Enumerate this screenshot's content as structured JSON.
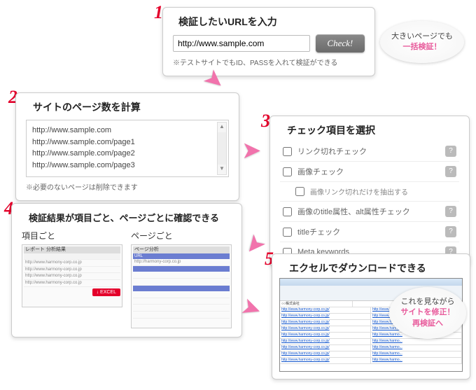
{
  "step1": {
    "num": "1",
    "title": "検証したいURLを入力",
    "input_value": "http://www.sample.com",
    "button": "Check!",
    "note": "※テストサイトでもID、PASSを入れて検証ができる"
  },
  "bubble1_line1": "大きいページでも",
  "bubble1_line2": "一括検証！",
  "step2": {
    "num": "2",
    "title": "サイトのページ数を計算",
    "urls": [
      "http://www.sample.com",
      "http://www.sample.com/page1",
      "http://www.sample.com/page2",
      "http://www.sample.com/page3"
    ],
    "note": "※必要のないページは削除できます"
  },
  "step3": {
    "num": "3",
    "title": "チェック項目を選択",
    "items": [
      "リンク切れチェック",
      "画像チェック",
      "画像リンク切れだけを抽出する",
      "画像のtitle属性、alt属性チェック",
      "titleチェック",
      "Meta keywords"
    ]
  },
  "step4": {
    "num": "4",
    "title": "検証結果が項目ごと、ページごとに確認できる",
    "col1": "項目ごと",
    "col2": "ページごと",
    "report_label": "レポート  分析結果",
    "page_label": "ページ分析",
    "excel_btn": "↓ EXCEL"
  },
  "step5": {
    "num": "5",
    "title": "エクセルでダウンロードできる"
  },
  "bubble2_line1": "これを見ながら",
  "bubble2_line2": "サイトを修正！",
  "bubble2_line3": "再検証へ"
}
